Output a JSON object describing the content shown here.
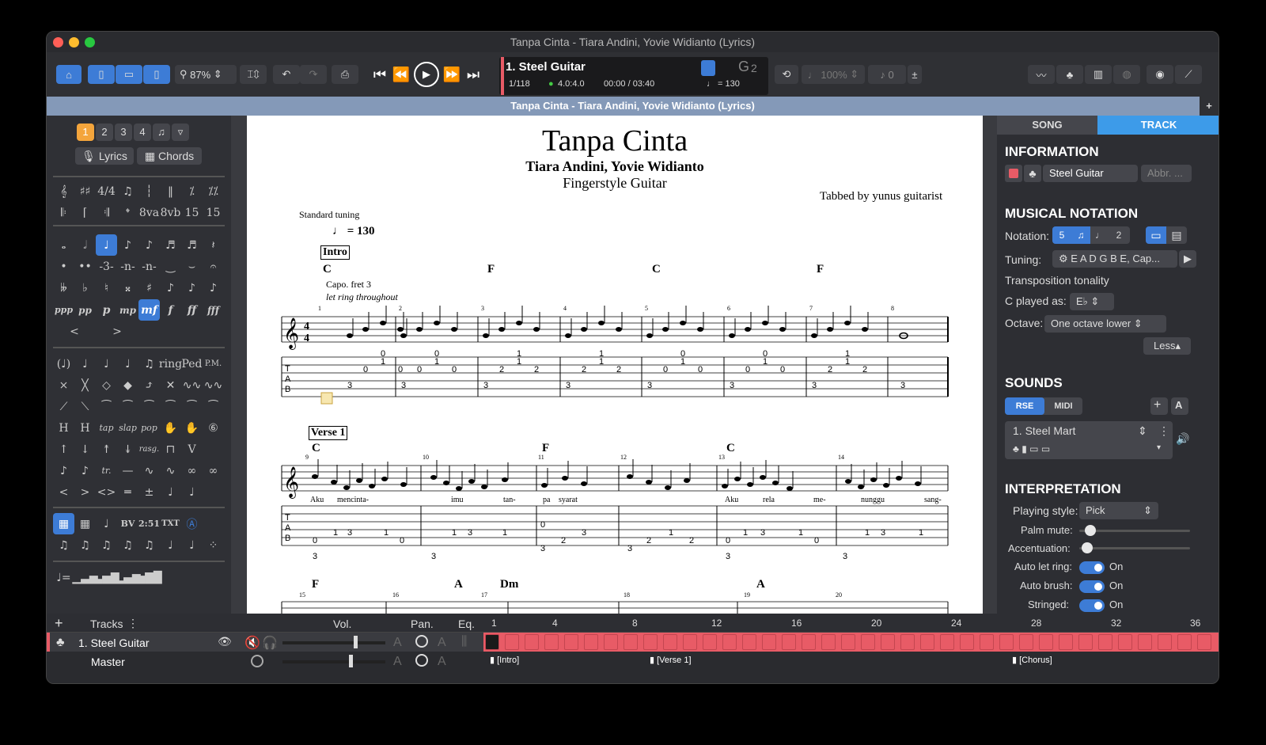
{
  "window": {
    "title": "Tanpa Cinta - Tiara Andini, Yovie Widianto (Lyrics)"
  },
  "toolbar": {
    "zoom": "87%",
    "track_name": "1. Steel Guitar",
    "bar_pos": "1/118",
    "sig": "4.0:4.0",
    "time": "00:00 / 03:40",
    "tempo": "♩ = 130",
    "key_display": "G",
    "key_sub": "2",
    "speed": "100%",
    "tune_val": "0"
  },
  "docbar": {
    "title": "Tanpa Cinta - Tiara Andini, Yovie Widianto (Lyrics)",
    "add": "+"
  },
  "left": {
    "voices": [
      "1",
      "2",
      "3",
      "4"
    ],
    "lyrics": "Lyrics",
    "chords": "Chords",
    "dynamics": [
      "ppp",
      "pp",
      "p",
      "mp",
      "mf",
      "f",
      "ff",
      "fff"
    ],
    "effects": [
      "tap",
      "slap",
      "pop",
      "rasg.",
      "tr.",
      "BV",
      "2:51",
      "TXT",
      "P.M."
    ]
  },
  "score": {
    "title": "Tanpa Cinta",
    "artist": "Tiara Andini, Yovie Widianto",
    "subtitle": "Fingerstyle Guitar",
    "tabbed_by": "Tabbed by yunus guitarist",
    "tuning": "Standard tuning",
    "tempo": "= 130",
    "section1": "Intro",
    "section2": "Verse 1",
    "capo": "Capo. fret 3",
    "letring": "let ring throughout",
    "chords1": [
      "C",
      "F",
      "C",
      "F"
    ],
    "chords2": [
      "C",
      "F",
      "C"
    ],
    "chords3": [
      "F",
      "A",
      "Dm",
      "A"
    ],
    "lyrics": [
      "Aku",
      "mencinta-",
      "imu",
      "tan-",
      "pa",
      "syarat",
      "Aku",
      "rela",
      "me-",
      "nunggu",
      "sang-"
    ],
    "bars1": [
      "1",
      "2",
      "3",
      "4",
      "5",
      "6",
      "7",
      "8"
    ],
    "bars2": [
      "9",
      "10",
      "11",
      "12",
      "13",
      "14"
    ],
    "bars3": [
      "15",
      "16",
      "17",
      "18",
      "19",
      "20"
    ]
  },
  "right": {
    "tabs": [
      "SONG",
      "TRACK"
    ],
    "information": "INFORMATION",
    "track_name": "Steel Guitar",
    "abbr_placeholder": "Abbr. ...",
    "musical_notation": "MUSICAL NOTATION",
    "notation_label": "Notation:",
    "tuning_label": "Tuning:",
    "tuning_value": "E A D G B E, Cap...",
    "transposition": "Transposition tonality",
    "c_played_label": "C played as:",
    "c_played_value": "E♭",
    "octave_label": "Octave:",
    "octave_value": "One octave lower",
    "less": "Less",
    "sounds": "SOUNDS",
    "rse": "RSE",
    "midi": "MIDI",
    "sound_name": "1. Steel Mart",
    "interpretation": "INTERPRETATION",
    "playing_style_label": "Playing style:",
    "playing_style_value": "Pick",
    "palm_mute": "Palm mute:",
    "palm_mute_level": 0.1,
    "accentuation": "Accentuation:",
    "accentuation_level": 0.07,
    "auto_let_ring": "Auto let ring:",
    "auto_brush": "Auto brush:",
    "stringed": "Stringed:",
    "on": "On"
  },
  "bottom": {
    "tracks_label": "Tracks",
    "vol": "Vol.",
    "pan": "Pan.",
    "eq": "Eq.",
    "track1": "1. Steel Guitar",
    "master": "Master",
    "ruler": [
      "1",
      "4",
      "8",
      "12",
      "16",
      "20",
      "24",
      "28",
      "32",
      "36"
    ],
    "markers": [
      "[Intro]",
      "[Verse 1]",
      "[Chorus]"
    ]
  }
}
